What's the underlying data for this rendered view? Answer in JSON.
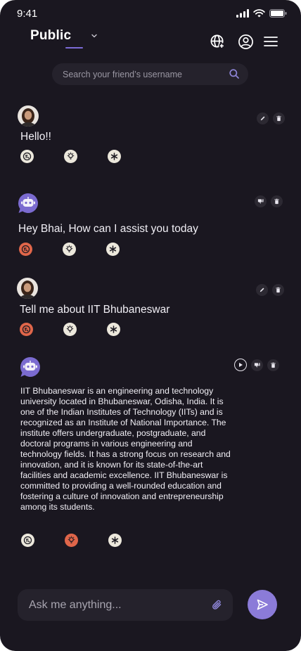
{
  "status_bar": {
    "time": "9:41"
  },
  "header": {
    "title": "Public"
  },
  "search": {
    "placeholder": "Search your friend’s username"
  },
  "messages": [
    {
      "role": "user",
      "text": "Hello!!"
    },
    {
      "role": "bot",
      "text": "Hey Bhai, How can I assist you today"
    },
    {
      "role": "user",
      "text": "Tell me about IIT Bhubaneswar"
    },
    {
      "role": "bot",
      "text": "IIT Bhubaneswar is an engineering and technology university located in Bhubaneswar, Odisha, India. It is one of the Indian Institutes of Technology (IITs) and is recognized as an Institute of National Importance. The institute offers undergraduate, postgraduate, and doctoral programs in various engineering and technology fields. It has a strong focus on research and innovation, and it is known for its state-of-the-art facilities and academic excellence. IIT Bhubaneswar is committed to providing a well-rounded education and fostering a culture of innovation and entrepreneurship among its students."
    }
  ],
  "composer": {
    "placeholder": "Ask me anything..."
  },
  "colors": {
    "background": "#1a1720",
    "accent": "#8b7bd8",
    "surface": "#25222c",
    "react_orange": "#e0664a"
  }
}
